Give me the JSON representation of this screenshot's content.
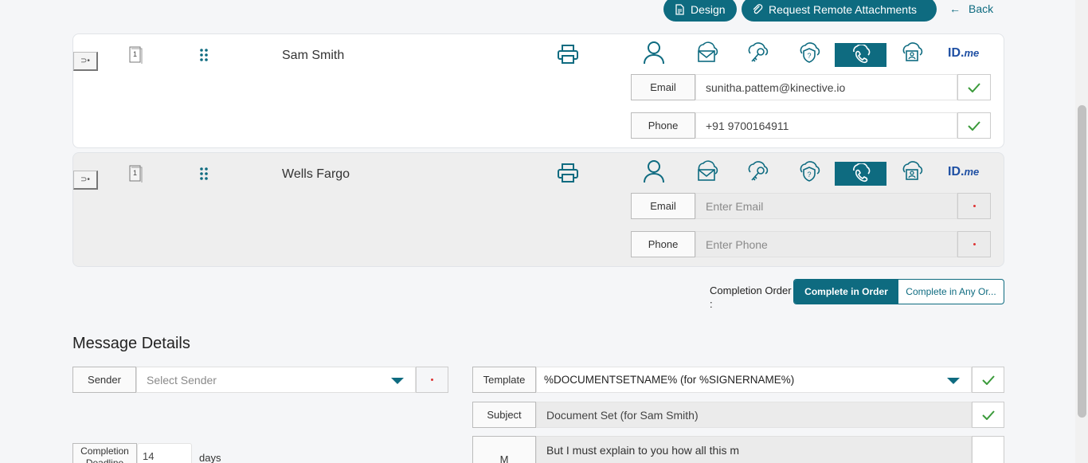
{
  "toolbar": {
    "design_label": "Design",
    "request_label": "Request Remote Attachments",
    "back_label": "Back"
  },
  "recipients": [
    {
      "order": "1",
      "name": "Sam Smith",
      "email_label": "Email",
      "email_value": "sunitha.pattem@kinective.io",
      "phone_label": "Phone",
      "phone_value": "+91 9700164911",
      "idme": "ID.",
      "idme_suffix": "me"
    },
    {
      "order": "1",
      "name": "Wells Fargo",
      "email_label": "Email",
      "email_placeholder": "Enter Email",
      "phone_label": "Phone",
      "phone_placeholder": "Enter Phone",
      "idme": "ID.",
      "idme_suffix": "me"
    }
  ],
  "completion_order": {
    "label": "Completion Order",
    "colon": ":",
    "in_order": "Complete in Order",
    "any_order": "Complete in Any Or..."
  },
  "message": {
    "title": "Message Details",
    "sender_label": "Sender",
    "sender_placeholder": "Select Sender",
    "template_label": "Template",
    "template_value": "%DOCUMENTSETNAME% (for %SIGNERNAME%)",
    "subject_label": "Subject",
    "subject_value": "Document Set (for Sam Smith)",
    "message_label": "M",
    "message_value": "But I must explain to you how all this m",
    "deadline_label": "Completion Deadline",
    "deadline_value": "14",
    "days_label": "days"
  },
  "colors": {
    "accent": "#0e6b80",
    "check": "#3a9a3a",
    "required": "#dd3333"
  },
  "icons": [
    "document-icon",
    "paperclip-icon",
    "arrow-left-icon",
    "enter-icon",
    "page-icon",
    "drag-handle-icon",
    "printer-icon",
    "person-icon",
    "cloud-mail-icon",
    "cloud-key-icon",
    "cloud-shield-icon",
    "phone-icon",
    "cloud-id-icon",
    "check-icon",
    "caret-down-icon"
  ]
}
